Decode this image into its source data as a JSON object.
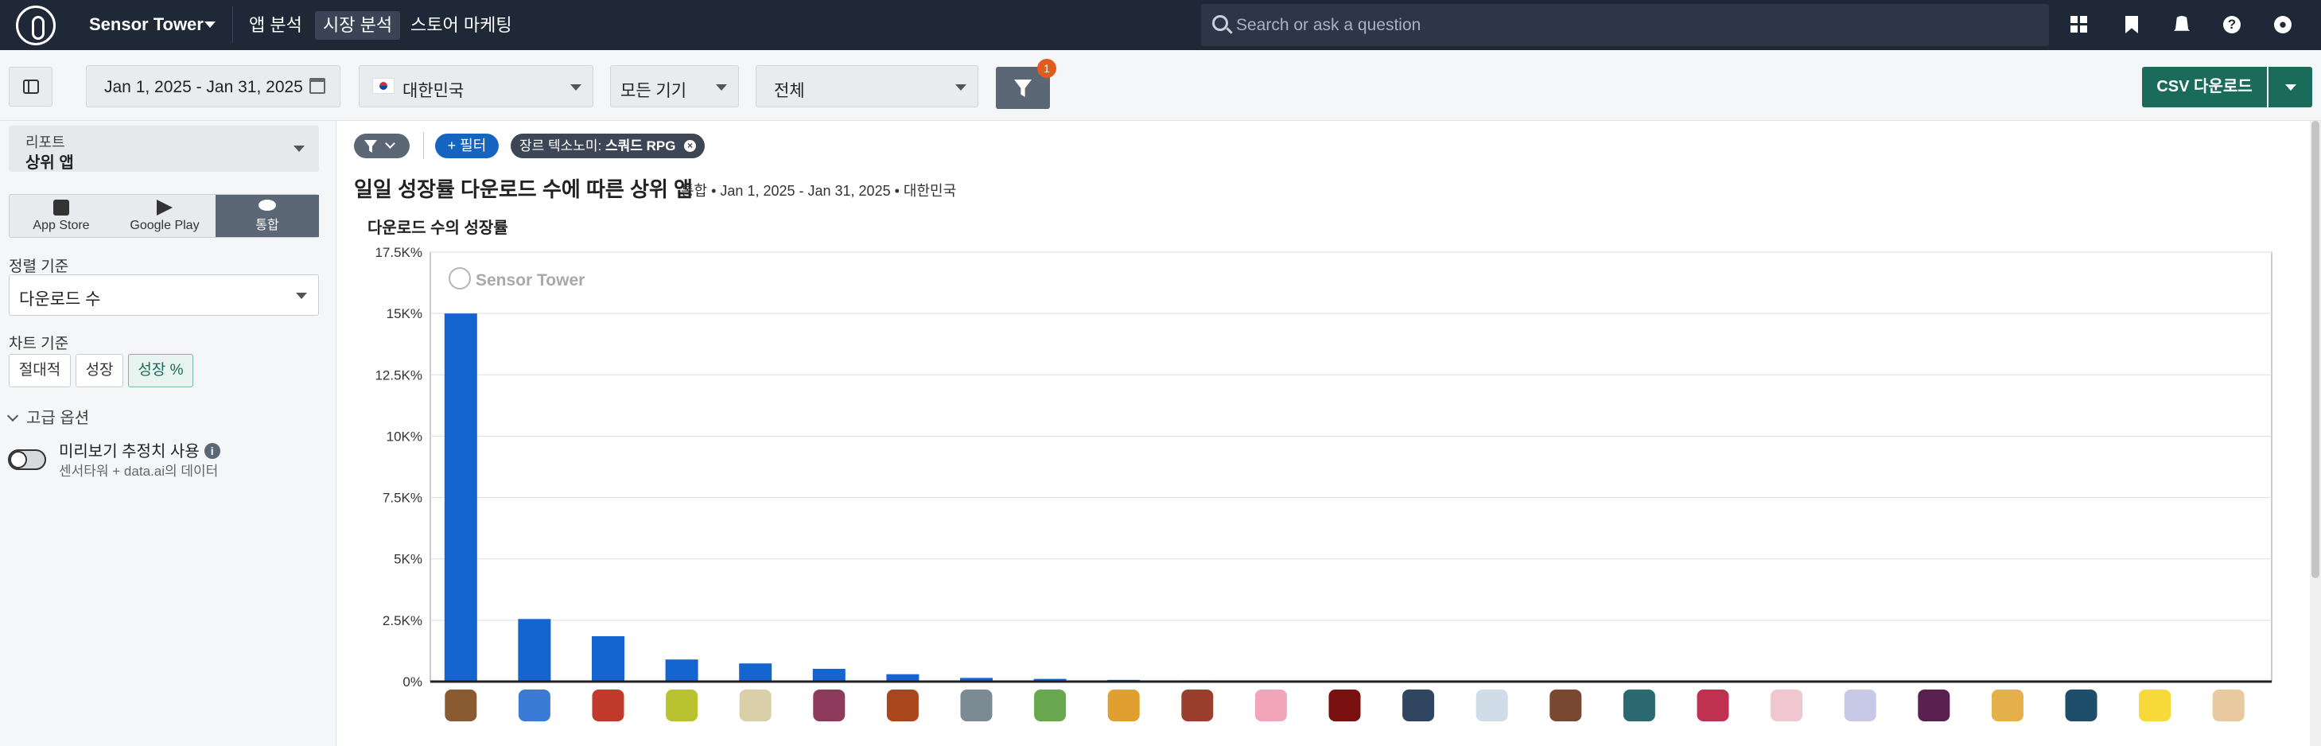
{
  "header": {
    "brand": "Sensor Tower",
    "nav": [
      {
        "label": "앱 분석",
        "active": false
      },
      {
        "label": "시장 분석",
        "active": true
      },
      {
        "label": "스토어 마케팅",
        "active": false
      }
    ],
    "search_placeholder": "Search or ask a question",
    "icons": [
      "grid-icon",
      "bookmark-icon",
      "bell-icon",
      "help-icon",
      "user-icon"
    ]
  },
  "toolbar": {
    "date_range": "Jan 1, 2025 - Jan 31, 2025",
    "country": "대한민국",
    "device": "모든 기기",
    "category": "전체",
    "filter_count": "1",
    "csv_label": "CSV 다운로드"
  },
  "sidebar": {
    "report_label": "리포트",
    "report_value": "상위 앱",
    "stores": [
      {
        "label": "App Store",
        "icon": "app-store-icon",
        "active": false
      },
      {
        "label": "Google Play",
        "icon": "google-play-icon",
        "active": false
      },
      {
        "label": "통합",
        "icon": "unified-icon",
        "active": true
      }
    ],
    "sort_label": "정렬 기준",
    "sort_value": "다운로드 수",
    "chart_basis_label": "차트 기준",
    "chart_basis": [
      {
        "label": "절대적",
        "active": false
      },
      {
        "label": "성장",
        "active": false
      },
      {
        "label": "성장 %",
        "active": true
      }
    ],
    "advanced_label": "고급 옵션",
    "preview_label": "미리보기 추정치 사용",
    "preview_sub": "센서타워 + data.ai의 데이터"
  },
  "main": {
    "filter_add": "+ 필터",
    "genre_chip_prefix": "장르 텍소노미: ",
    "genre_chip_value": "스쿼드 RPG",
    "title": "일일 성장률 다운로드 수에 따른 상위 앱",
    "subtitle": "통합 • Jan 1, 2025 - Jan 31, 2025 • 대한민국",
    "watermark": "Sensor Tower"
  },
  "chart_data": {
    "type": "bar",
    "title": "",
    "ylabel": "다운로드 수의 성장률",
    "ylim": [
      0,
      17500
    ],
    "yticks": [
      {
        "value": 0,
        "label": "0%"
      },
      {
        "value": 2500,
        "label": "2.5K%"
      },
      {
        "value": 5000,
        "label": "5K%"
      },
      {
        "value": 7500,
        "label": "7.5K%"
      },
      {
        "value": 10000,
        "label": "10K%"
      },
      {
        "value": 12500,
        "label": "12.5K%"
      },
      {
        "value": 15000,
        "label": "15K%"
      },
      {
        "value": 17500,
        "label": "17.5K%"
      }
    ],
    "grid": true,
    "values": [
      15000,
      2550,
      1850,
      900,
      740,
      520,
      300,
      150,
      110,
      70,
      50,
      10,
      5,
      4,
      3,
      3,
      2,
      2,
      2,
      1,
      1,
      1,
      1,
      1,
      1
    ],
    "colors": {
      "bar": "#1565d0",
      "grid": "#dddddd",
      "axis": "#222222"
    },
    "icon_colors": [
      "#8a5a32",
      "#3a7bd5",
      "#c0392b",
      "#b9c32f",
      "#d9cfa8",
      "#8e3a5c",
      "#a8471b",
      "#7c8a94",
      "#6aa84f",
      "#e0a030",
      "#9a3f2e",
      "#f2a5b8",
      "#7a1010",
      "#2f4560",
      "#d0dce8",
      "#7a4830",
      "#2b6a70",
      "#c03050",
      "#f0c6d0",
      "#c7c9e6",
      "#5a2050",
      "#e5b04a",
      "#1d4f6a",
      "#f7d93a",
      "#e8c9a0"
    ]
  }
}
